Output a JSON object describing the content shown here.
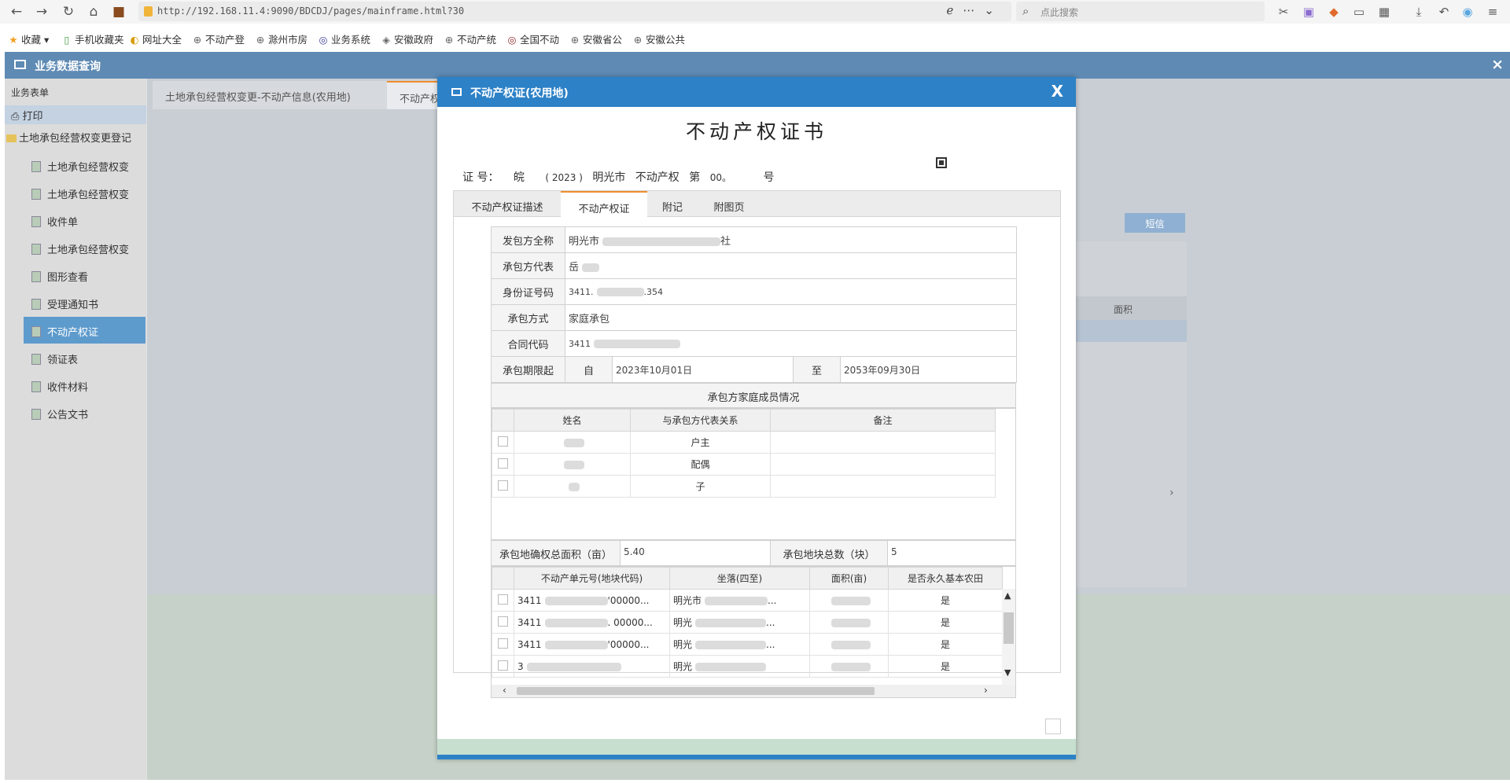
{
  "browser": {
    "url": "http://192.168.11.4:9090/BDCDJ/pages/mainframe.html?30",
    "search_placeholder": "点此搜索"
  },
  "bookmarks": [
    {
      "label": "收藏",
      "icon": "star-icon"
    },
    {
      "label": "手机收藏夹",
      "icon": "phone-icon"
    },
    {
      "label": "网址大全",
      "icon": "globe-icon"
    },
    {
      "label": "不动产登",
      "icon": "globe-icon"
    },
    {
      "label": "滁州市房",
      "icon": "globe-icon"
    },
    {
      "label": "业务系统",
      "icon": "globe-icon"
    },
    {
      "label": "安徽政府",
      "icon": "globe-icon"
    },
    {
      "label": "不动产统",
      "icon": "globe-icon"
    },
    {
      "label": "全国不动",
      "icon": "globe-icon"
    },
    {
      "label": "安徽省公",
      "icon": "globe-icon"
    },
    {
      "label": "安徽公共",
      "icon": "globe-icon"
    }
  ],
  "app": {
    "title": "业务数据查询",
    "close": "×"
  },
  "sidebar": {
    "heading": "业务表单",
    "print": "打印",
    "group": "土地承包经营权变更登记",
    "items": [
      {
        "label": "土地承包经营权变"
      },
      {
        "label": "土地承包经营权变"
      },
      {
        "label": "收件单"
      },
      {
        "label": "土地承包经营权变"
      },
      {
        "label": "图形查看"
      },
      {
        "label": "受理通知书"
      },
      {
        "label": "不动产权证"
      },
      {
        "label": "领证表"
      },
      {
        "label": "收件材料"
      },
      {
        "label": "公告文书"
      }
    ]
  },
  "content": {
    "tabs": [
      {
        "label": "土地承包经营权变更-不动产信息(农用地)"
      },
      {
        "label": "不动产权"
      }
    ],
    "sms_button": "短信",
    "column_area": "面积",
    "right_arrow": "›"
  },
  "modal": {
    "title": "不动产权证(农用地)",
    "close": "X",
    "cert_title": "不动产权证书",
    "cert_no": {
      "label": "证 号：",
      "province": "皖",
      "year": "( 2023 )",
      "city": "明光市",
      "type": "不动产权",
      "di": "第",
      "seq": "00。",
      "hao": "号"
    },
    "tabs": [
      {
        "label": "不动产权证描述"
      },
      {
        "label": "不动产权证"
      },
      {
        "label": "附记"
      },
      {
        "label": "附图页"
      }
    ],
    "form": {
      "issuer_label": "发包方全称",
      "issuer_value": "明光市",
      "issuer_suffix": "社",
      "rep_label": "承包方代表",
      "rep_value": "岳",
      "id_label": "身份证号码",
      "id_value": "3411.",
      "id_suffix": ".354",
      "method_label": "承包方式",
      "method_value": "家庭承包",
      "contract_label": "合同代码",
      "contract_value": "3411",
      "period_label": "承包期限起",
      "from_label": "自",
      "from_value": "2023年10月01日",
      "to_label": "至",
      "to_value": "2053年09月30日"
    },
    "family": {
      "title": "承包方家庭成员情况",
      "columns": [
        "姓名",
        "与承包方代表关系",
        "备注"
      ],
      "rows": [
        {
          "relation": "户主"
        },
        {
          "relation": "配偶"
        },
        {
          "relation": "子"
        }
      ]
    },
    "area": {
      "total_label": "承包地确权总面积（亩）",
      "total_value": "5.40",
      "count_label": "承包地块总数（块）",
      "count_value": "5"
    },
    "parcels": {
      "columns": [
        "不动产单元号(地块代码)",
        "坐落(四至)",
        "面积(亩)",
        "是否永久基本农田"
      ],
      "rows": [
        {
          "code": "3411",
          "code_tail": "'00000...",
          "loc": "明光市",
          "loc_tail": "...",
          "basic": "是"
        },
        {
          "code": "3411",
          "code_tail": ". 00000...",
          "loc": "明光",
          "loc_tail": "...",
          "basic": "是"
        },
        {
          "code": "3411",
          "code_tail": "'00000...",
          "loc": "明光",
          "loc_tail": "...",
          "basic": "是"
        },
        {
          "code": "3",
          "code_tail": "",
          "loc": "明光",
          "loc_tail": "",
          "basic": "是"
        }
      ]
    }
  }
}
